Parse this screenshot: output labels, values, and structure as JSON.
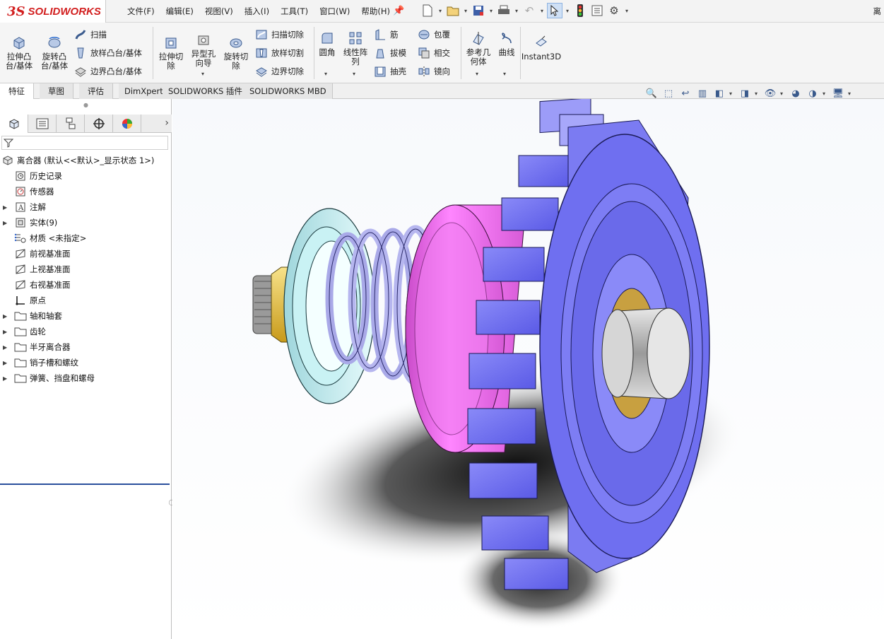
{
  "app": {
    "brand_ds": "3S",
    "brand_name": "SOLIDWORKS",
    "doc_title": "离"
  },
  "menu": [
    "文件(F)",
    "编辑(E)",
    "视图(V)",
    "插入(I)",
    "工具(T)",
    "窗口(W)",
    "帮助(H)"
  ],
  "ribbon": {
    "extrude_boss": "拉伸凸\n台/基体",
    "revolve_boss": "旋转凸\n台/基体",
    "sweep": "扫描",
    "loft_boss": "放样凸台/基体",
    "boundary_boss": "边界凸台/基体",
    "extrude_cut": "拉伸切\n除",
    "hole_wizard": "异型孔\n向导",
    "revolve_cut": "旋转切\n除",
    "swept_cut": "扫描切除",
    "lofted_cut": "放样切割",
    "boundary_cut": "边界切除",
    "fillet": "圆角",
    "linear_pattern": "线性阵\n列",
    "rib": "筋",
    "draft": "拔模",
    "shell": "抽壳",
    "wrap": "包覆",
    "intersect": "相交",
    "mirror": "镜向",
    "ref_geometry": "参考几\n何体",
    "curves": "曲线",
    "instant3d": "Instant3D"
  },
  "tabs": [
    "特征",
    "草图",
    "评估",
    "DimXpert",
    "SOLIDWORKS 插件",
    "SOLIDWORKS MBD"
  ],
  "tree": {
    "root": "离合器 (默认<<默认>_显示状态 1>)",
    "items": [
      {
        "label": "历史记录",
        "icon": "history-icon",
        "expandable": false
      },
      {
        "label": "传感器",
        "icon": "sensor-icon",
        "expandable": false
      },
      {
        "label": "注解",
        "icon": "annotation-icon",
        "expandable": true
      },
      {
        "label": "实体(9)",
        "icon": "solid-bodies-icon",
        "expandable": true
      },
      {
        "label": "材质 <未指定>",
        "icon": "material-icon",
        "expandable": false
      },
      {
        "label": "前视基准面",
        "icon": "plane-icon",
        "expandable": false
      },
      {
        "label": "上视基准面",
        "icon": "plane-icon",
        "expandable": false
      },
      {
        "label": "右视基准面",
        "icon": "plane-icon",
        "expandable": false
      },
      {
        "label": "原点",
        "icon": "origin-icon",
        "expandable": false
      },
      {
        "label": "轴和轴套",
        "icon": "folder-icon",
        "expandable": true
      },
      {
        "label": "齿轮",
        "icon": "folder-icon",
        "expandable": true
      },
      {
        "label": "半牙离合器",
        "icon": "folder-icon",
        "expandable": true
      },
      {
        "label": "销子槽和螺纹",
        "icon": "folder-icon",
        "expandable": true
      },
      {
        "label": "弹簧、挡盘和螺母",
        "icon": "folder-icon",
        "expandable": true
      }
    ]
  },
  "colors": {
    "gear": "#6f6ff0",
    "clutch": "#e46ae4",
    "disc": "#b9ecef",
    "spring": "#b8b8ee",
    "nut": "#e8c84a",
    "shaft": "#c8c8c8"
  }
}
